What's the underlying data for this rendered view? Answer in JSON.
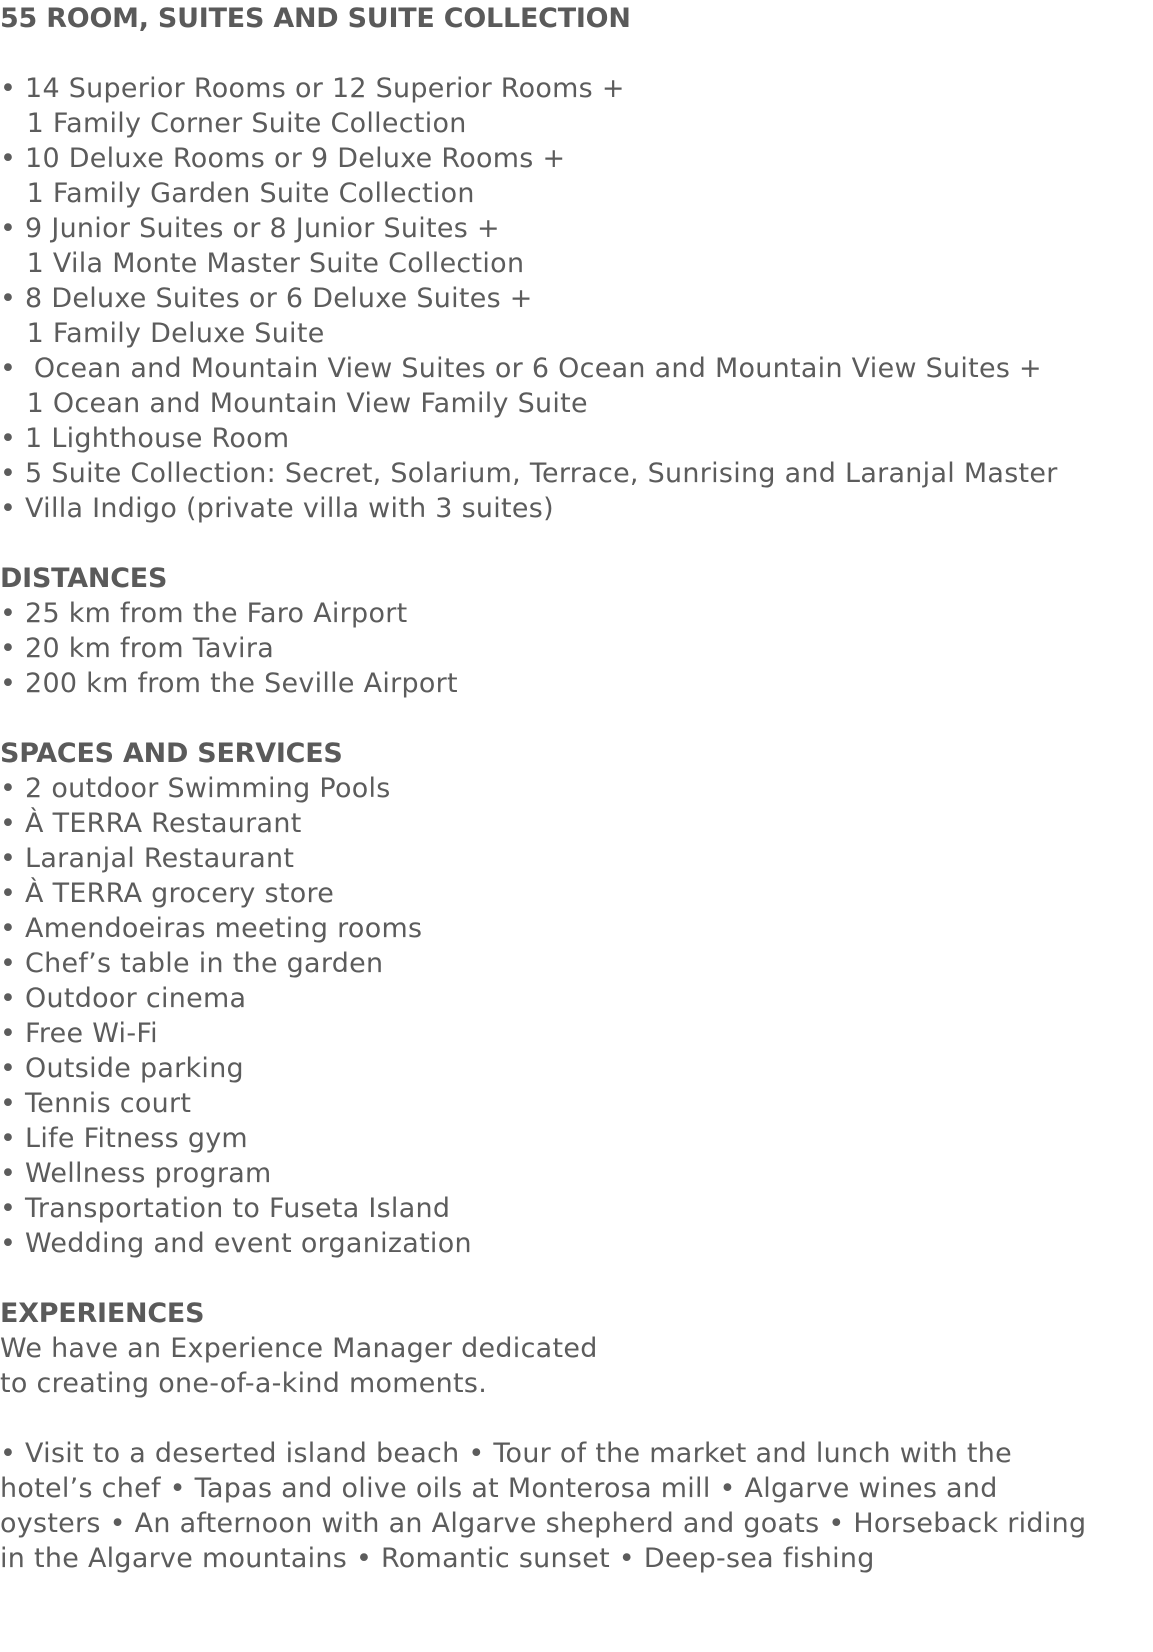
{
  "rooms_section": {
    "heading": "55 ROOM, SUITES AND SUITE COLLECTION",
    "lines": [
      "• 14 Superior Rooms or 12 Superior Rooms +",
      "   1 Family Corner Suite Collection",
      "• 10 Deluxe Rooms or 9 Deluxe Rooms +",
      "   1 Family Garden Suite Collection",
      "• 9 Junior Suites or 8 Junior Suites +",
      "   1 Vila Monte Master Suite Collection",
      "• 8 Deluxe Suites or 6 Deluxe Suites +",
      "   1 Family Deluxe Suite",
      "•  Ocean and Mountain View Suites or 6 Ocean and Mountain View Suites +",
      "   1 Ocean and Mountain View Family Suite",
      "• 1 Lighthouse Room",
      "• 5 Suite Collection: Secret, Solarium, Terrace, Sunrising and Laranjal Master",
      "• Villa Indigo (private villa with 3 suites)"
    ]
  },
  "distances_section": {
    "heading": "DISTANCES",
    "lines": [
      "• 25 km from the Faro Airport",
      "• 20 km from Tavira",
      "• 200 km from the Seville Airport"
    ]
  },
  "services_section": {
    "heading": "SPACES AND SERVICES",
    "lines": [
      "• 2 outdoor Swimming Pools",
      "• À TERRA Restaurant",
      "• Laranjal Restaurant",
      "• À TERRA grocery store",
      "• Amendoeiras meeting rooms",
      "• Chef’s table in the garden",
      "• Outdoor cinema",
      "• Free Wi-Fi",
      "• Outside parking",
      "• Tennis court",
      "• Life Fitness gym",
      "• Wellness program",
      "• Transportation to Fuseta Island",
      "• Wedding and event organization"
    ]
  },
  "experiences_section": {
    "heading": "EXPERIENCES",
    "intro_lines": [
      "We have an Experience Manager dedicated",
      "to creating one-of-a-kind moments."
    ],
    "list_lines": [
      "• Visit to a deserted island beach • Tour of the market and lunch with the",
      "hotel’s chef • Tapas and olive oils at Monterosa mill • Algarve wines and",
      "oysters • An afternoon with an Algarve shepherd and goats • Horseback riding",
      "in the Algarve mountains • Romantic sunset • Deep-sea fishing"
    ]
  }
}
